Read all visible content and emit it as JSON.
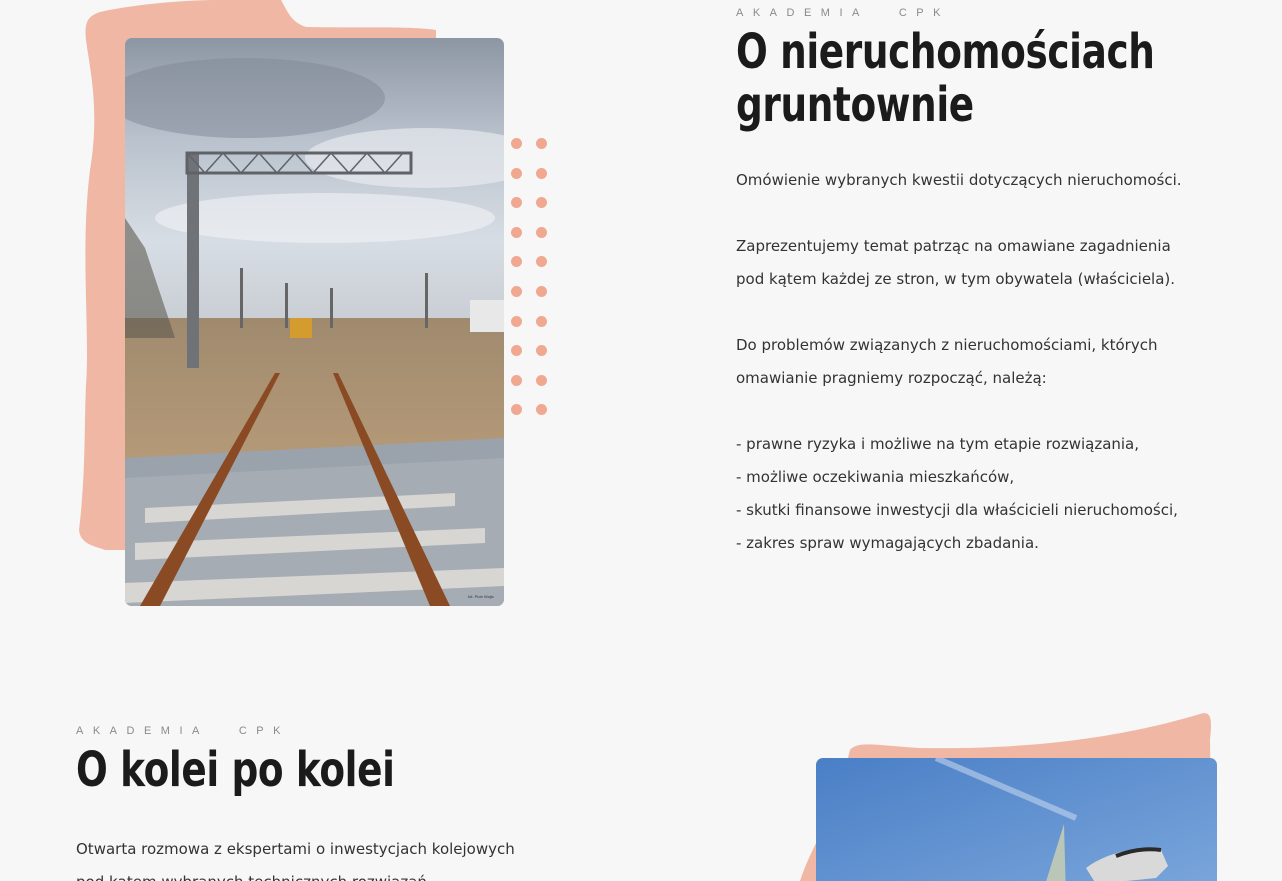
{
  "section1": {
    "kicker_word1": "AKADEMIA",
    "kicker_word2": "CPK",
    "title_line1": "O nieruchomościach",
    "title_line2": "gruntownie",
    "intro": "Omówienie wybranych kwestii dotyczących nieruchomości.",
    "para2_line1": "Zaprezentujemy temat patrząc na omawiane zagadnienia",
    "para2_line2": "pod kątem każdej ze stron, w tym obywatela (właściciela).",
    "para3_line1": "Do problemów związanych z nieruchomościami, których",
    "para3_line2": "omawianie pragniemy rozpocząć, należą:",
    "bullets": [
      "- prawne ryzyka i możliwe na tym etapie rozwiązania,",
      "- możliwe oczekiwania mieszkańców,",
      "- skutki finansowe inwestycji dla właścicieli nieruchomości,",
      "- zakres spraw wymagających zbadania."
    ],
    "photo_credit": "fot. Piotr Wojtc",
    "photo_subject": "railway-track-construction-photo"
  },
  "section2": {
    "kicker_word1": "AKADEMIA",
    "kicker_word2": "CPK",
    "title": "O kolei po kolei",
    "para1_line1": "Otwarta rozmowa z ekspertami o inwestycjach kolejowych",
    "para1_line2": "pod kątem wybranych technicznych rozwiązań.",
    "photo_subject": "railway-station-roof-photo"
  },
  "colors": {
    "background": "#f7f7f7",
    "accent_blob": "#f0b8a4",
    "dot": "#f0a890",
    "heading": "#1b1b1b",
    "body_text": "#333333"
  }
}
